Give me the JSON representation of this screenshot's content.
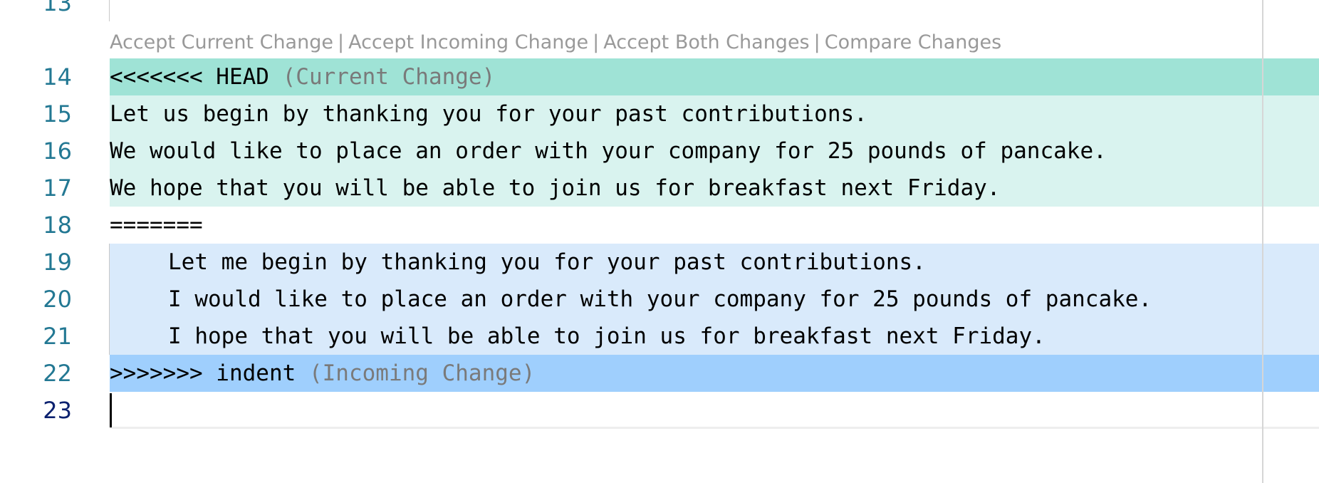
{
  "gutter": {
    "line_numbers": [
      "13",
      "14",
      "15",
      "16",
      "17",
      "18",
      "19",
      "20",
      "21",
      "22",
      "23"
    ]
  },
  "codelens": {
    "accept_current": "Accept Current Change",
    "accept_incoming": "Accept Incoming Change",
    "accept_both": "Accept Both Changes",
    "compare": "Compare Changes",
    "separator": "|"
  },
  "lines": {
    "l14_marker": "<<<<<<< HEAD ",
    "l14_hint": "(Current Change)",
    "l15": "Let us begin by thanking you for your past contributions.",
    "l16": "We would like to place an order with your company for 25 pounds of pancake.",
    "l17": "We hope that you will be able to join us for breakfast next Friday.",
    "l18": "=======",
    "l19": "Let me begin by thanking you for your past contributions.",
    "l20": "I would like to place an order with your company for 25 pounds of pancake.",
    "l21": "I hope that you will be able to join us for breakfast next Friday.",
    "l22_marker": ">>>>>>> indent ",
    "l22_hint": "(Incoming Change)",
    "l23": ""
  },
  "colors": {
    "current_header": "#9fe3d6",
    "current_body": "#d9f3ef",
    "incoming_body": "#d9eafb",
    "incoming_header": "#9fcffd",
    "line_number": "#237893",
    "active_line_number": "#0b216f"
  }
}
